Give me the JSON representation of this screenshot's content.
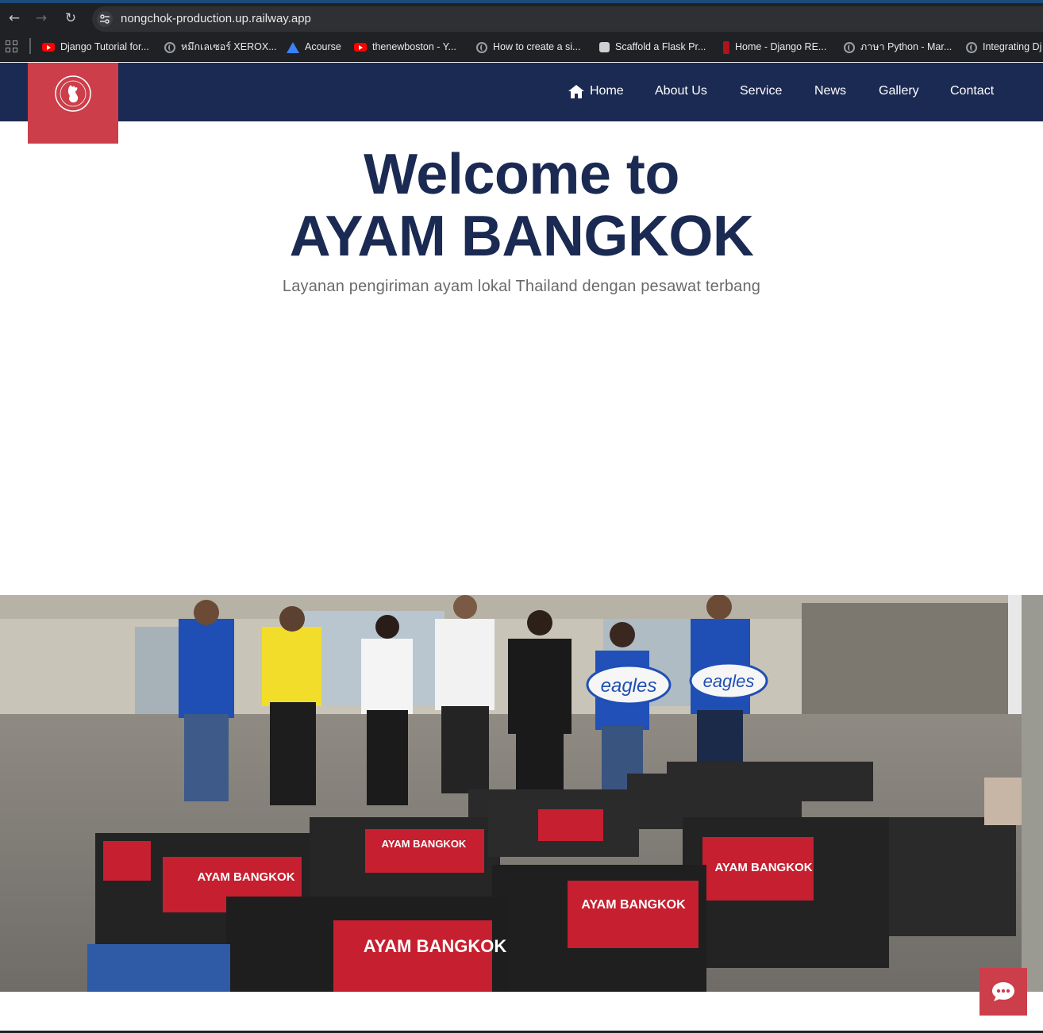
{
  "browser": {
    "url": "nongchok-production.up.railway.app",
    "bookmarks": [
      {
        "label": "Django Tutorial for...",
        "icon": "youtube-icon"
      },
      {
        "label": "หมึกเลเซอร์ XEROX...",
        "icon": "globe-icon"
      },
      {
        "label": "Acourse",
        "icon": "acourse-icon"
      },
      {
        "label": "thenewboston - Y...",
        "icon": "youtube-icon"
      },
      {
        "label": "How to create a si...",
        "icon": "globe-icon"
      },
      {
        "label": "Scaffold a Flask Pr...",
        "icon": "puzzle-icon"
      },
      {
        "label": "Home - Django RE...",
        "icon": "django-icon"
      },
      {
        "label": "ภาษา Python - Mar...",
        "icon": "globe-icon"
      },
      {
        "label": "Integrating Dj",
        "icon": "globe-icon"
      }
    ]
  },
  "site": {
    "logo_text": "AYAM BANGKOK",
    "nav": {
      "home": "Home",
      "about": "About Us",
      "service": "Service",
      "news": "News",
      "gallery": "Gallery",
      "contact": "Contact"
    },
    "hero": {
      "title_line1": "Welcome to",
      "title_line2": "AYAM BANGKOK",
      "subtitle": "Layanan pengiriman ayam lokal Thailand dengan pesawat terbang"
    },
    "photo": {
      "crate_label": "AYAM BANGKOK",
      "sign_label": "eagles"
    }
  },
  "colors": {
    "navy": "#1b2a52",
    "brand_red": "#cc3e4a",
    "subtitle_gray": "#6a6a6a"
  }
}
